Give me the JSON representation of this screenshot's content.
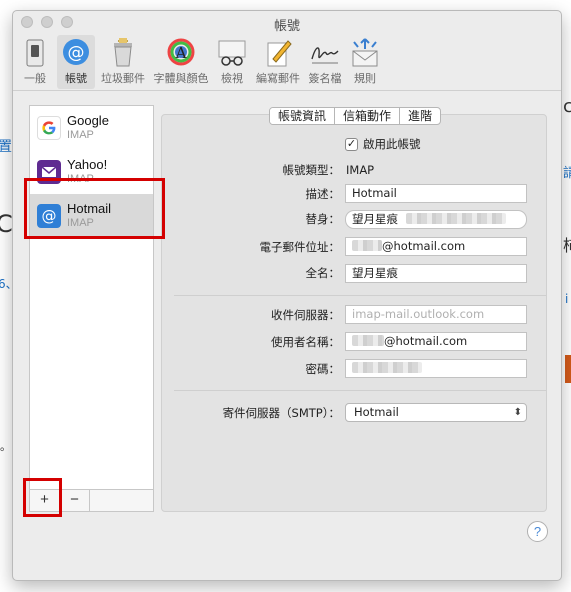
{
  "window": {
    "title": "帳號"
  },
  "background": {
    "fragments": [
      "置",
      "C",
      "6、",
      "請",
      "c",
      "i",
      "柿",
      "。",
      "。"
    ],
    "accent_color": "#1a6fc4",
    "orange_color": "#d35a1a"
  },
  "toolbar": {
    "items": [
      {
        "label": "一般",
        "icon": "switch-icon"
      },
      {
        "label": "帳號",
        "icon": "at-sign-icon",
        "active": true
      },
      {
        "label": "垃圾郵件",
        "icon": "trash-bin-icon"
      },
      {
        "label": "字體與顏色",
        "icon": "fonts-colors-icon"
      },
      {
        "label": "檢視",
        "icon": "glasses-icon"
      },
      {
        "label": "編寫郵件",
        "icon": "pencil-paper-icon"
      },
      {
        "label": "簽名檔",
        "icon": "signature-icon"
      },
      {
        "label": "規則",
        "icon": "rules-envelope-icon"
      }
    ]
  },
  "accounts": [
    {
      "name": "Google",
      "type": "IMAP",
      "icon": "google-icon",
      "color": "#ffffff"
    },
    {
      "name": "Yahoo!",
      "type": "IMAP",
      "icon": "yahoo-mail-icon",
      "color": "#5f2b91"
    },
    {
      "name": "Hotmail",
      "type": "IMAP",
      "icon": "at-sign-icon",
      "color": "#2f7fd6",
      "selected": true
    }
  ],
  "list_controls": {
    "add": "+",
    "remove": "−"
  },
  "tabs": [
    "帳號資訊",
    "信箱動作",
    "進階"
  ],
  "form": {
    "enable_label": "啟用此帳號",
    "enabled": true,
    "type_label": "帳號類型：",
    "type_value": "IMAP",
    "description_label": "描述：",
    "description_value": "Hotmail",
    "alias_label": "替身：",
    "alias_value": "望月星痕",
    "email_label": "電子郵件位址：",
    "email_value": "@hotmail.com",
    "fullname_label": "全名：",
    "fullname_value": "望月星痕",
    "incoming_label": "收件伺服器：",
    "incoming_placeholder": "imap-mail.outlook.com",
    "username_label": "使用者名稱：",
    "username_value": "@hotmail.com",
    "password_label": "密碼：",
    "smtp_label": "寄件伺服器（SMTP）：",
    "smtp_value": "Hotmail"
  },
  "help": {
    "label": "?"
  },
  "highlight_color": "#d40000"
}
